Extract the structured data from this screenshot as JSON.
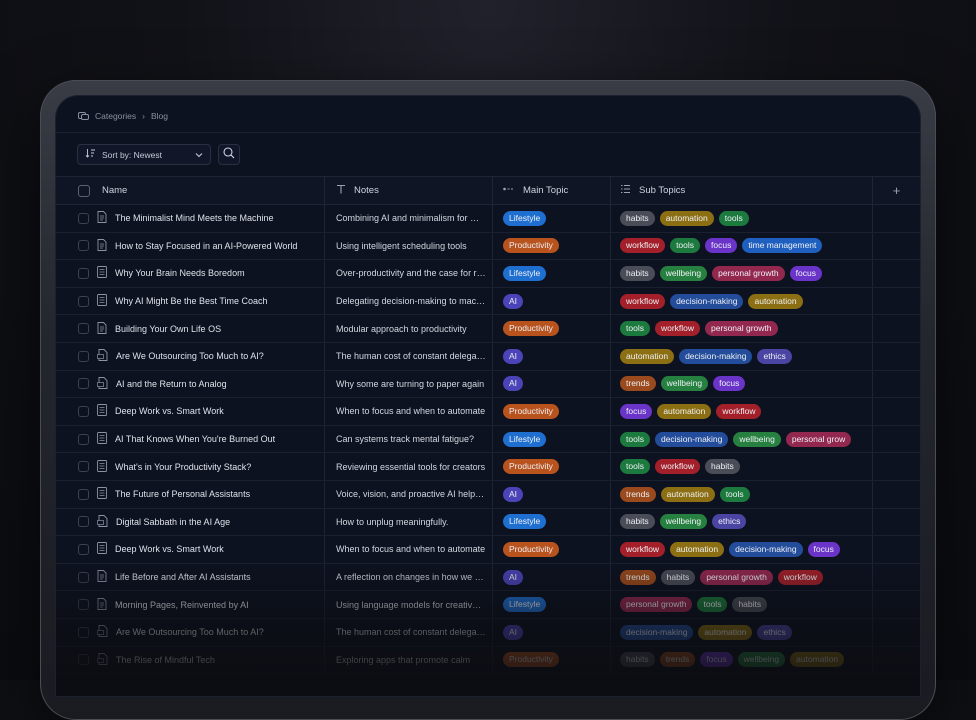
{
  "breadcrumb": {
    "root": "Categories",
    "separator": "›",
    "current": "Blog"
  },
  "toolbar": {
    "sort_label": "Sort by: Newest"
  },
  "columns": {
    "name": "Name",
    "notes": "Notes",
    "main_topic": "Main Topic",
    "sub_topics": "Sub Topics",
    "add": "+"
  },
  "topic_colors": {
    "Lifestyle": "#1f6fd0",
    "Productivity": "#b8531e",
    "AI": "#4b43b8"
  },
  "tag_colors": {
    "habits": "#4a4d58",
    "automation": "#8c6f12",
    "tools": "#1c7a3e",
    "workflow": "#a3202a",
    "focus": "#6b34c9",
    "time management": "#1e5fbf",
    "wellbeing": "#26803f",
    "personal growth": "#93284f",
    "decision-making": "#234c9a",
    "ethics": "#4a45a3",
    "trends": "#9a4a1c"
  },
  "rows": [
    {
      "name": "The Minimalist Mind Meets the Machine",
      "icon": "doc",
      "notes": "Combining AI and minimalism for mental clarity",
      "topic": "Lifestyle",
      "subs": [
        "habits",
        "automation",
        "tools"
      ]
    },
    {
      "name": "How to Stay Focused in an AI-Powered World",
      "icon": "doc",
      "notes": "Using intelligent scheduling tools",
      "topic": "Productivity",
      "subs": [
        "workflow",
        "tools",
        "focus",
        "time management"
      ]
    },
    {
      "name": "Why Your Brain Needs Boredom",
      "icon": "page",
      "notes": "Over-productivity and the case for rest",
      "topic": "Lifestyle",
      "subs": [
        "habits",
        "wellbeing",
        "personal growth",
        "focus"
      ]
    },
    {
      "name": "Why AI Might Be the Best Time Coach",
      "icon": "page",
      "notes": "Delegating decision-making to machines",
      "topic": "AI",
      "subs": [
        "workflow",
        "decision-making",
        "automation"
      ]
    },
    {
      "name": "Building Your Own Life OS",
      "icon": "doc",
      "notes": "Modular approach to productivity",
      "topic": "Productivity",
      "subs": [
        "tools",
        "workflow",
        "personal growth"
      ]
    },
    {
      "name": "Are We Outsourcing Too Much to AI?",
      "icon": "pdf",
      "notes": "The human cost of constant delegation",
      "topic": "AI",
      "subs": [
        "automation",
        "decision-making",
        "ethics"
      ]
    },
    {
      "name": "AI and the Return to Analog",
      "icon": "pdf",
      "notes": "Why some are turning to paper again",
      "topic": "AI",
      "subs": [
        "trends",
        "wellbeing",
        "focus"
      ]
    },
    {
      "name": "Deep Work vs. Smart Work",
      "icon": "page",
      "notes": "When to focus and when to automate",
      "topic": "Productivity",
      "subs": [
        "focus",
        "automation",
        "workflow"
      ]
    },
    {
      "name": "AI That Knows When You're Burned Out",
      "icon": "page",
      "notes": "Can systems track mental fatigue?",
      "topic": "Lifestyle",
      "subs": [
        "tools",
        "decision-making",
        "wellbeing",
        "personal grow"
      ]
    },
    {
      "name": "What's in Your Productivity Stack?",
      "icon": "page",
      "notes": "Reviewing essential tools for creators",
      "topic": "Productivity",
      "subs": [
        "tools",
        "workflow",
        "habits"
      ]
    },
    {
      "name": "The Future of Personal Assistants",
      "icon": "page",
      "notes": "Voice, vision, and proactive AI helpers",
      "topic": "AI",
      "subs": [
        "trends",
        "automation",
        "tools"
      ]
    },
    {
      "name": "Digital Sabbath in the AI Age",
      "icon": "pdf",
      "notes": "How to unplug meaningfully.",
      "topic": "Lifestyle",
      "subs": [
        "habits",
        "wellbeing",
        "ethics"
      ]
    },
    {
      "name": "Deep Work vs. Smart Work",
      "icon": "page",
      "notes": "When to focus and when to automate",
      "topic": "Productivity",
      "subs": [
        "workflow",
        "automation",
        "decision-making",
        "focus"
      ]
    },
    {
      "name": "Life Before and After AI Assistants",
      "icon": "doc",
      "notes": "A reflection on changes in how we work",
      "topic": "AI",
      "subs": [
        "trends",
        "habits",
        "personal growth",
        "workflow"
      ]
    },
    {
      "name": "Morning Pages, Reinvented by AI",
      "icon": "doc",
      "notes": "Using language models for creative writing",
      "topic": "Lifestyle",
      "subs": [
        "personal growth",
        "tools",
        "habits"
      ]
    },
    {
      "name": "Are We Outsourcing Too Much to AI?",
      "icon": "pdf",
      "notes": "The human cost of constant delegation",
      "topic": "AI",
      "subs": [
        "decision-making",
        "automation",
        "ethics"
      ]
    },
    {
      "name": "The Rise of Mindful Tech",
      "icon": "pdf",
      "notes": "Exploring apps that promote calm",
      "topic": "Productivity",
      "subs": [
        "habits",
        "trends",
        "focus",
        "wellbeing",
        "automation"
      ]
    }
  ]
}
